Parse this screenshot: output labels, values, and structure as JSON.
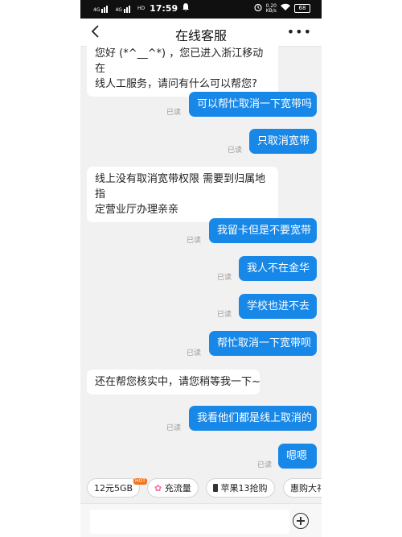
{
  "status_bar": {
    "network1": "4G",
    "network2": "4G",
    "hd": "HD",
    "time": "17:59",
    "speed_value": "0.20",
    "speed_unit": "KB/s",
    "battery": "68"
  },
  "header": {
    "title": "在线客服",
    "more": "•••"
  },
  "read_label": "已读",
  "messages": [
    {
      "side": "left",
      "text": "您好 (*^__^*) ，您已进入浙江移动在\n线人工服务，请问有什么可以帮您?"
    },
    {
      "side": "right",
      "text": "可以帮忙取消一下宽带吗"
    },
    {
      "side": "right",
      "text": "只取消宽带"
    },
    {
      "side": "left",
      "text": "线上没有取消宽带权限 需要到归属地指\n定营业厅办理亲亲"
    },
    {
      "side": "right",
      "text": "我留卡但是不要宽带"
    },
    {
      "side": "right",
      "text": "我人不在金华"
    },
    {
      "side": "right",
      "text": "学校也进不去"
    },
    {
      "side": "right",
      "text": "帮忙取消一下宽带呗"
    },
    {
      "side": "left",
      "text": "还在帮您核实中，请您稍等我一下~"
    },
    {
      "side": "right",
      "text": "我看他们都是线上取消的"
    },
    {
      "side": "right",
      "text": "嗯嗯"
    }
  ],
  "quick_replies": [
    {
      "label": "12元5GB",
      "badge": "HOT"
    },
    {
      "label": "充流量",
      "icon": "flower-icon"
    },
    {
      "label": "苹果13抢购",
      "icon": "phone-icon"
    },
    {
      "label": "惠购大礼"
    }
  ],
  "input": {
    "placeholder": ""
  }
}
